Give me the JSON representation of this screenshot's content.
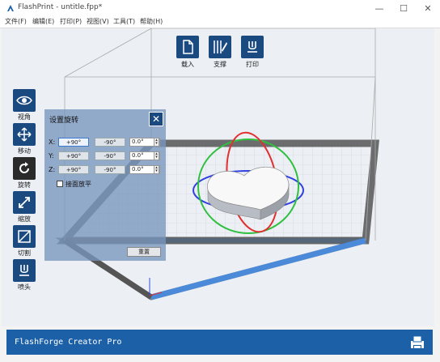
{
  "window": {
    "title": "FlashPrint - untitle.fpp*",
    "minimize_icon": "minimize-icon",
    "maximize_icon": "maximize-icon",
    "close_icon": "close-icon"
  },
  "menu": [
    {
      "label": "文件(F)"
    },
    {
      "label": "编辑(E)"
    },
    {
      "label": "打印(P)"
    },
    {
      "label": "视图(V)"
    },
    {
      "label": "工具(T)"
    },
    {
      "label": "帮助(H)"
    }
  ],
  "toolbar": {
    "load": {
      "label": "载入",
      "icon": "file-icon"
    },
    "support": {
      "label": "支撑",
      "icon": "support-icon"
    },
    "print": {
      "label": "打印",
      "icon": "print-icon"
    }
  },
  "sidebar": [
    {
      "label": "视角",
      "icon": "eye-icon"
    },
    {
      "label": "移动",
      "icon": "move-icon"
    },
    {
      "label": "旋转",
      "icon": "rotate-icon",
      "active": true
    },
    {
      "label": "缩放",
      "icon": "scale-icon"
    },
    {
      "label": "切割",
      "icon": "cut-icon"
    },
    {
      "label": "喷头",
      "icon": "nozzle-icon"
    }
  ],
  "rotate_panel": {
    "title": "设置旋转",
    "axes": [
      {
        "axis": "X:",
        "plus": "+90°",
        "minus": "-90°",
        "value": "0.0°"
      },
      {
        "axis": "Y:",
        "plus": "+90°",
        "minus": "-90°",
        "value": "0.0°"
      },
      {
        "axis": "Z:",
        "plus": "+90°",
        "minus": "-90°",
        "value": "0.0°"
      }
    ],
    "lay_flat_label": "接面放平",
    "reset_label": "重置"
  },
  "status": {
    "printer": "FlashForge Creator Pro",
    "icon": "printer-icon"
  },
  "colors": {
    "accent": "#1c61a8",
    "panel": "#7896be",
    "rotate_red": "#e03030",
    "rotate_green": "#30c040",
    "rotate_blue": "#3040e0"
  }
}
